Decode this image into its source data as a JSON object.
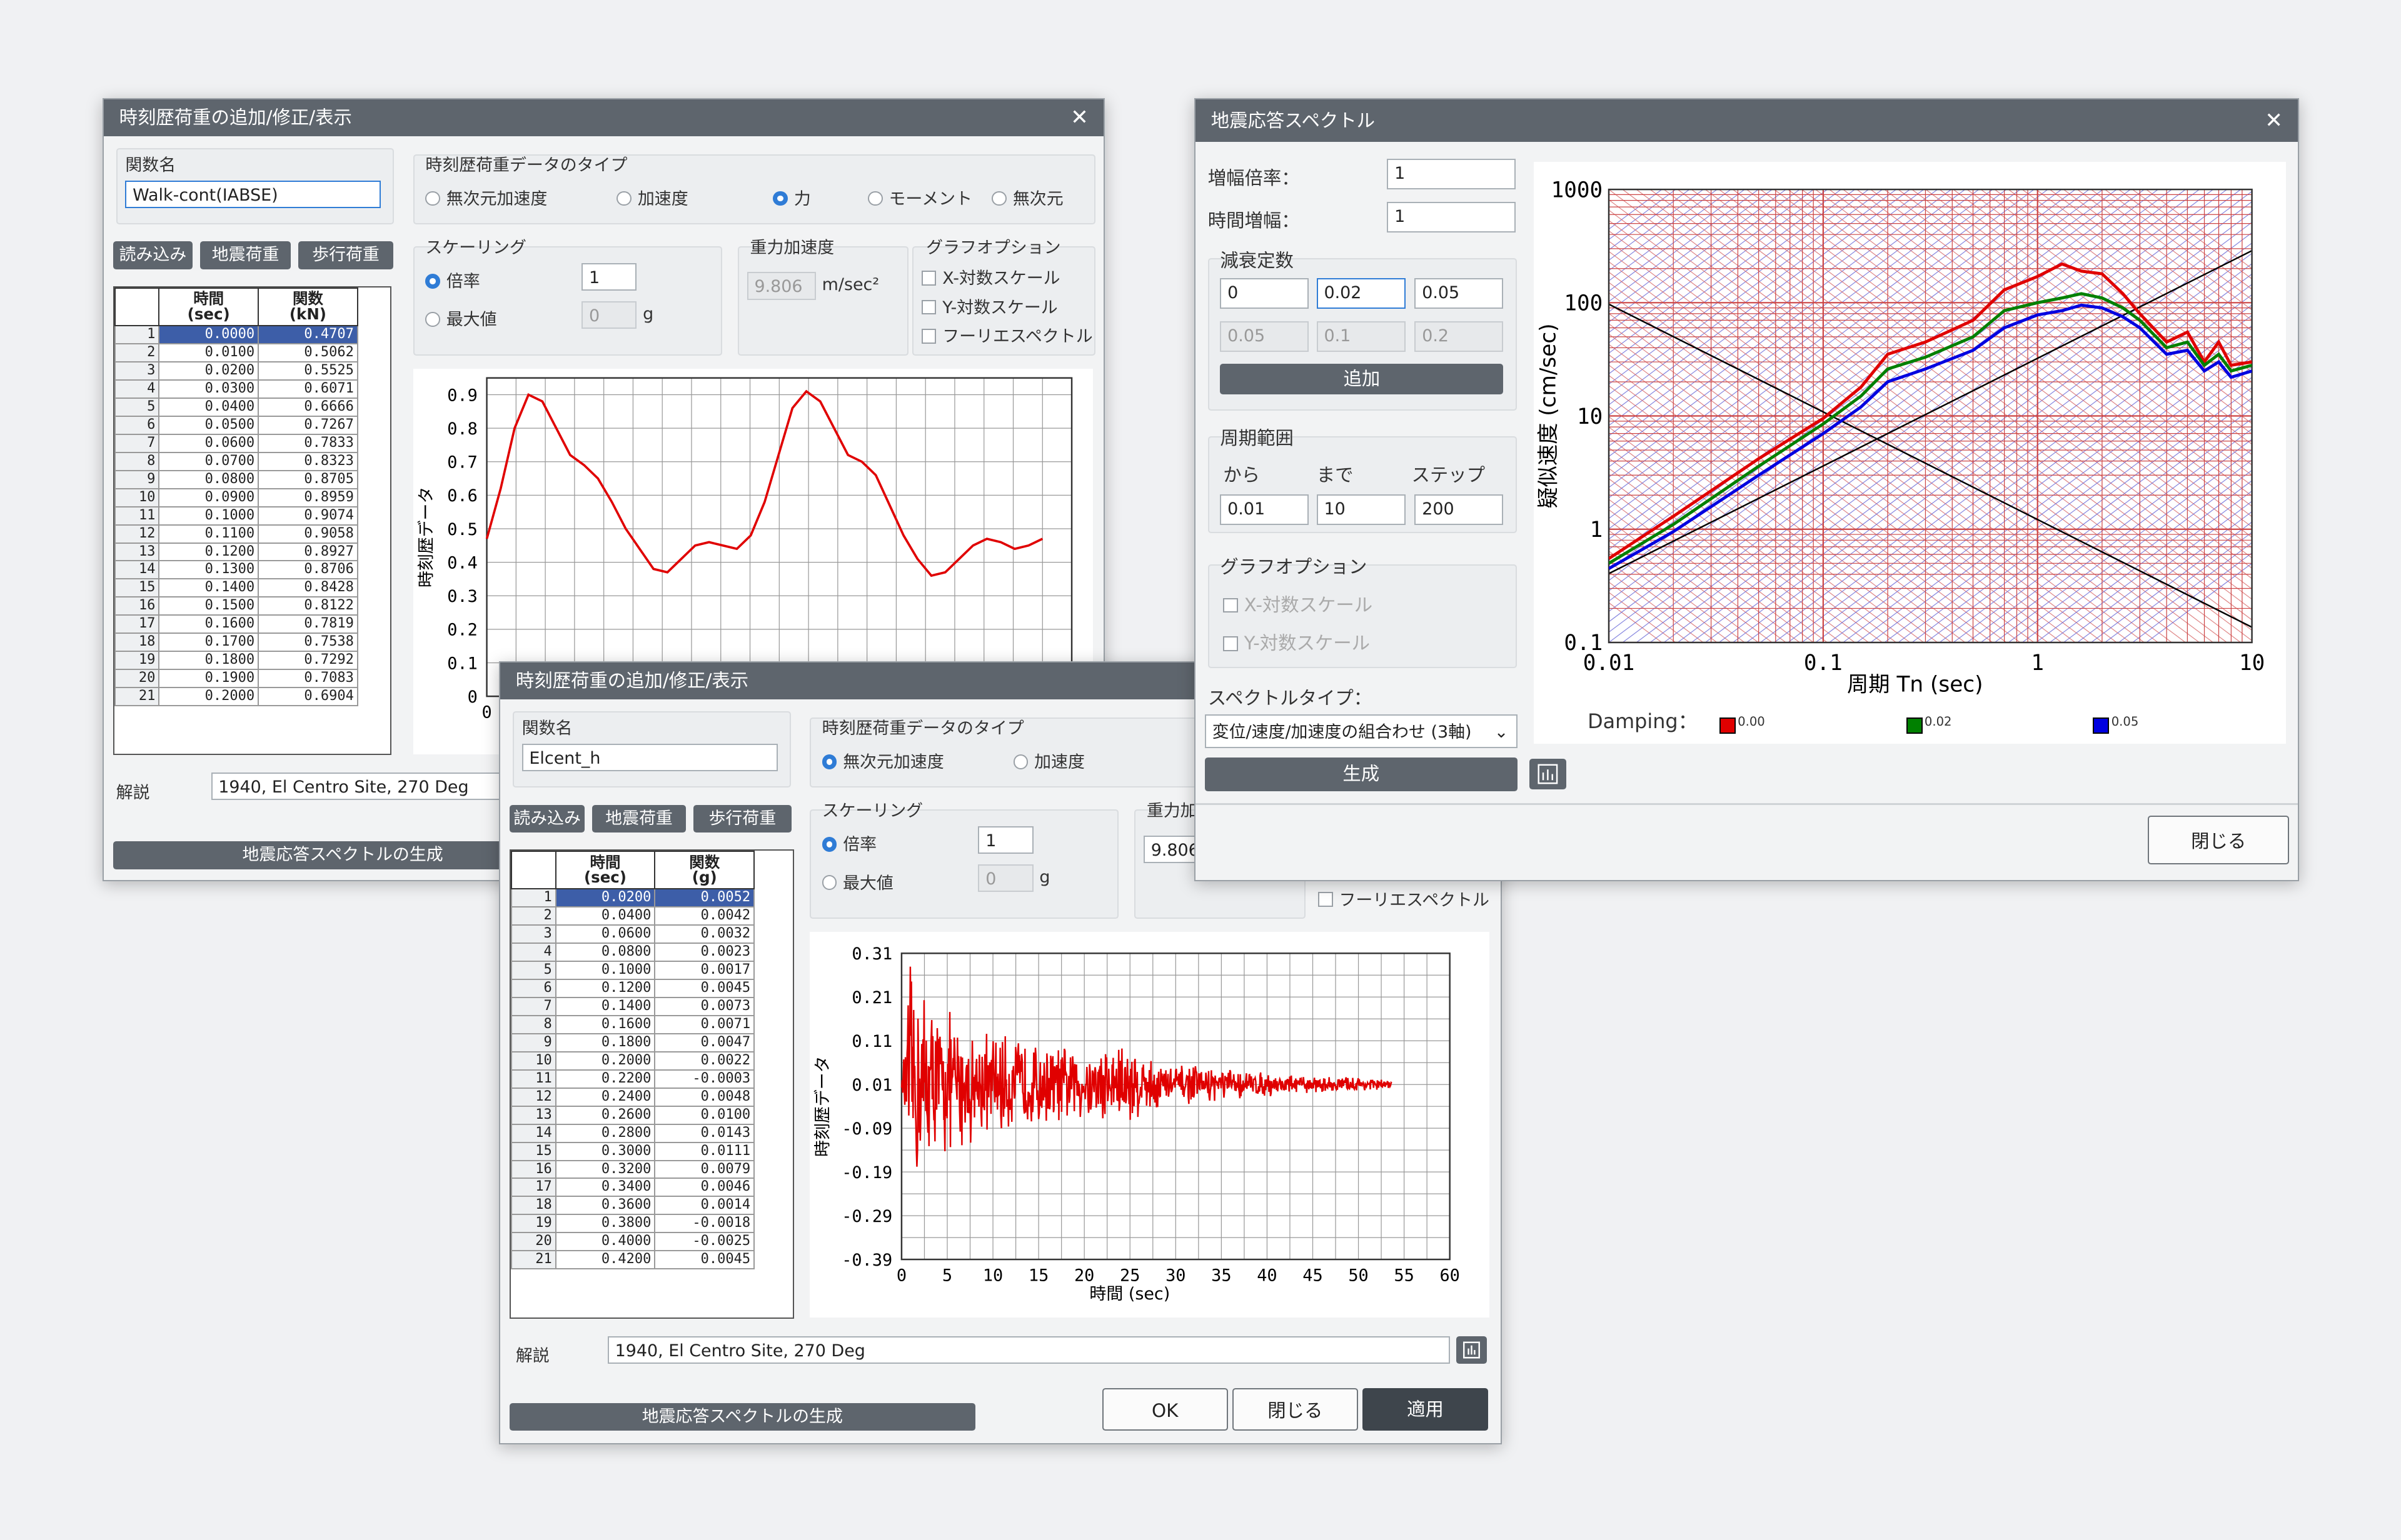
{
  "win1": {
    "title": "時刻歴荷重の追加/修正/表示",
    "close": "✕",
    "func_name_label": "関数名",
    "func_name_value": "Walk-cont(IABSE)",
    "buttons": [
      "読み込み",
      "地震荷重",
      "歩行荷重"
    ],
    "type_label": "時刻歴荷重データのタイプ",
    "types": [
      "無次元加速度",
      "加速度",
      "力",
      "モーメント",
      "無次元"
    ],
    "selected_type": "力",
    "scaling_label": "スケーリング",
    "scale_factor_label": "倍率",
    "scale_factor_value": "1",
    "max_label": "最大値",
    "max_value": "0",
    "max_unit": "g",
    "gravity_label": "重力加速度",
    "gravity_value": "9.806",
    "gravity_unit": "m/sec²",
    "graph_opt_label": "グラフオプション",
    "graph_opts": [
      "X-対数スケール",
      "Y-対数スケール",
      "フーリエスペクトル"
    ],
    "table_headers": [
      "時間\n(sec)",
      "関数\n(kN)"
    ],
    "table_rows": [
      [
        "1",
        "0.0000",
        "0.4707"
      ],
      [
        "2",
        "0.0100",
        "0.5062"
      ],
      [
        "3",
        "0.0200",
        "0.5525"
      ],
      [
        "4",
        "0.0300",
        "0.6071"
      ],
      [
        "5",
        "0.0400",
        "0.6666"
      ],
      [
        "6",
        "0.0500",
        "0.7267"
      ],
      [
        "7",
        "0.0600",
        "0.7833"
      ],
      [
        "8",
        "0.0700",
        "0.8323"
      ],
      [
        "9",
        "0.0800",
        "0.8705"
      ],
      [
        "10",
        "0.0900",
        "0.8959"
      ],
      [
        "11",
        "0.1000",
        "0.9074"
      ],
      [
        "12",
        "0.1100",
        "0.9058"
      ],
      [
        "13",
        "0.1200",
        "0.8927"
      ],
      [
        "14",
        "0.1300",
        "0.8706"
      ],
      [
        "15",
        "0.1400",
        "0.8428"
      ],
      [
        "16",
        "0.1500",
        "0.8122"
      ],
      [
        "17",
        "0.1600",
        "0.7819"
      ],
      [
        "18",
        "0.1700",
        "0.7538"
      ],
      [
        "19",
        "0.1800",
        "0.7292"
      ],
      [
        "20",
        "0.1900",
        "0.7083"
      ],
      [
        "21",
        "0.2000",
        "0.6904"
      ]
    ],
    "desc_label": "解説",
    "desc_value": "1940, El Centro Site, 270 Deg",
    "gen_button": "地震応答スペクトルの生成",
    "ylabel": "時刻歴データ",
    "yticks": [
      "0.9",
      "0.8",
      "0.7",
      "0.6",
      "0.5",
      "0.4",
      "0.3",
      "0.2",
      "0.1",
      "0"
    ],
    "xticks_visible": [
      "0"
    ]
  },
  "win2": {
    "title": "時刻歴荷重の追加/修正/表示",
    "func_name_label": "関数名",
    "func_name_value": "Elcent_h",
    "buttons": [
      "読み込み",
      "地震荷重",
      "歩行荷重"
    ],
    "type_label": "時刻歴荷重データのタイプ",
    "types": [
      "無次元加速度",
      "加速度"
    ],
    "selected_type": "無次元加速度",
    "scaling_label": "スケーリング",
    "scale_factor_label": "倍率",
    "scale_factor_value": "1",
    "max_label": "最大値",
    "max_value": "0",
    "max_unit": "g",
    "gravity_label": "重力加",
    "gravity_value": "9.806",
    "fourier_label": "フーリエスペクトル",
    "table_headers": [
      "時間\n(sec)",
      "関数\n(g)"
    ],
    "table_rows": [
      [
        "1",
        "0.0200",
        "0.0052"
      ],
      [
        "2",
        "0.0400",
        "0.0042"
      ],
      [
        "3",
        "0.0600",
        "0.0032"
      ],
      [
        "4",
        "0.0800",
        "0.0023"
      ],
      [
        "5",
        "0.1000",
        "0.0017"
      ],
      [
        "6",
        "0.1200",
        "0.0045"
      ],
      [
        "7",
        "0.1400",
        "0.0073"
      ],
      [
        "8",
        "0.1600",
        "0.0071"
      ],
      [
        "9",
        "0.1800",
        "0.0047"
      ],
      [
        "10",
        "0.2000",
        "0.0022"
      ],
      [
        "11",
        "0.2200",
        "-0.0003"
      ],
      [
        "12",
        "0.2400",
        "0.0048"
      ],
      [
        "13",
        "0.2600",
        "0.0100"
      ],
      [
        "14",
        "0.2800",
        "0.0143"
      ],
      [
        "15",
        "0.3000",
        "0.0111"
      ],
      [
        "16",
        "0.3200",
        "0.0079"
      ],
      [
        "17",
        "0.3400",
        "0.0046"
      ],
      [
        "18",
        "0.3600",
        "0.0014"
      ],
      [
        "19",
        "0.3800",
        "-0.0018"
      ],
      [
        "20",
        "0.4000",
        "-0.0025"
      ],
      [
        "21",
        "0.4200",
        "0.0045"
      ]
    ],
    "desc_label": "解説",
    "desc_value": "1940, El Centro Site, 270 Deg",
    "gen_button": "地震応答スペクトルの生成",
    "ok": "OK",
    "close_btn": "閉じる",
    "apply": "適用",
    "ylabel": "時刻歴データ",
    "xlabel": "時間 (sec)",
    "yticks": [
      "0.31",
      "0.21",
      "0.11",
      "0.01",
      "-0.09",
      "-0.19",
      "-0.29",
      "-0.39"
    ],
    "xticks": [
      "0",
      "5",
      "10",
      "15",
      "20",
      "25",
      "30",
      "35",
      "40",
      "45",
      "50",
      "55",
      "60"
    ]
  },
  "win3": {
    "title": "地震応答スペクトル",
    "close": "✕",
    "amp_label": "増幅倍率：",
    "amp_value": "1",
    "time_label": "時間増幅：",
    "time_value": "1",
    "damping_group": "減衰定数",
    "damping_values": [
      "0",
      "0.02",
      "0.05"
    ],
    "damping_disabled": [
      "0.05",
      "0.1",
      "0.2"
    ],
    "add_button": "追加",
    "period_group": "周期範囲",
    "from_label": "から",
    "to_label": "まで",
    "step_label": "ステップ",
    "from_value": "0.01",
    "to_value": "10",
    "step_value": "200",
    "graph_opt_label": "グラフオプション",
    "graph_opts": [
      "X-対数スケール",
      "Y-対数スケール"
    ],
    "spectrum_type_label": "スペクトルタイプ：",
    "spectrum_type_value": "変位/速度/加速度の組合わせ (3軸)",
    "generate_button": "生成",
    "close_button": "閉じる",
    "ylabel": "疑似速度 (cm/sec)",
    "xlabel": "周期 Tn (sec)",
    "yticks": [
      "1000",
      "100",
      "10",
      "1",
      "0.1"
    ],
    "xticks": [
      "0.01",
      "0.1",
      "1",
      "10"
    ],
    "damping_label": "Damping：",
    "legend": [
      {
        "name": "0.00",
        "color": "#e00000"
      },
      {
        "name": "0.02",
        "color": "#008000"
      },
      {
        "name": "0.05",
        "color": "#0000e0"
      }
    ]
  },
  "chart_data": [
    {
      "type": "line",
      "ylabel": "時刻歴データ",
      "ylim": [
        0,
        0.95
      ],
      "series": [
        {
          "color": "#e00000",
          "x": [
            0,
            0.0125,
            0.025,
            0.0375,
            0.05,
            0.0625,
            0.075,
            0.0875,
            0.1,
            0.1125,
            0.125,
            0.1375,
            0.15,
            0.1625,
            0.175,
            0.1875,
            0.2,
            0.2125,
            0.225,
            0.2375,
            0.25,
            0.2625,
            0.275,
            0.2875,
            0.3,
            0.3125,
            0.325,
            0.3375,
            0.35,
            0.3625,
            0.375,
            0.3875,
            0.4,
            0.4125,
            0.425,
            0.4375,
            0.45,
            0.4625,
            0.475,
            0.4875,
            0.5
          ],
          "values": [
            0.47,
            0.62,
            0.8,
            0.9,
            0.88,
            0.8,
            0.72,
            0.69,
            0.65,
            0.58,
            0.5,
            0.44,
            0.38,
            0.37,
            0.41,
            0.45,
            0.46,
            0.45,
            0.44,
            0.48,
            0.58,
            0.72,
            0.86,
            0.91,
            0.88,
            0.8,
            0.72,
            0.7,
            0.66,
            0.57,
            0.48,
            0.41,
            0.36,
            0.37,
            0.41,
            0.45,
            0.47,
            0.46,
            0.44,
            0.45,
            0.47
          ]
        }
      ]
    },
    {
      "type": "line",
      "xlabel": "時間 (sec)",
      "ylabel": "時刻歴データ",
      "xlim": [
        0,
        60
      ],
      "ylim": [
        -0.39,
        0.31
      ],
      "series": [
        {
          "color": "#e00000",
          "note_envelope": [
            [
              0,
              0.01
            ],
            [
              1,
              0.3
            ],
            [
              2,
              0.28
            ],
            [
              3,
              0.22
            ],
            [
              5,
              0.18
            ],
            [
              8,
              0.14
            ],
            [
              12,
              0.12
            ],
            [
              16,
              0.1
            ],
            [
              20,
              0.09
            ],
            [
              25,
              0.12
            ],
            [
              26,
              0.08
            ],
            [
              30,
              0.05
            ],
            [
              35,
              0.04
            ],
            [
              40,
              0.03
            ],
            [
              45,
              0.02
            ],
            [
              50,
              0.02
            ],
            [
              53.7,
              0.01
            ]
          ]
        }
      ]
    },
    {
      "type": "line",
      "xlabel": "周期 Tn (sec)",
      "ylabel": "疑似速度 (cm/sec)",
      "xscale": "log",
      "yscale": "log",
      "xlim": [
        0.01,
        10
      ],
      "ylim": [
        0.1,
        1000
      ],
      "series": [
        {
          "name": "0.00",
          "color": "#e00000",
          "x": [
            0.01,
            0.02,
            0.05,
            0.1,
            0.15,
            0.2,
            0.3,
            0.5,
            0.7,
            1,
            1.3,
            1.6,
            2,
            2.5,
            3,
            4,
            5,
            6,
            7,
            8,
            10
          ],
          "values": [
            0.55,
            1.3,
            4.2,
            9.5,
            18,
            35,
            45,
            70,
            130,
            170,
            220,
            190,
            180,
            120,
            80,
            45,
            55,
            30,
            45,
            28,
            30
          ]
        },
        {
          "name": "0.02",
          "color": "#008000",
          "x": [
            0.01,
            0.02,
            0.05,
            0.1,
            0.15,
            0.2,
            0.3,
            0.5,
            0.7,
            1,
            1.3,
            1.6,
            2,
            2.5,
            3,
            4,
            5,
            6,
            7,
            8,
            10
          ],
          "values": [
            0.5,
            1.1,
            3.6,
            8.5,
            15,
            26,
            33,
            50,
            85,
            100,
            110,
            120,
            110,
            90,
            70,
            40,
            45,
            28,
            35,
            25,
            28
          ]
        },
        {
          "name": "0.05",
          "color": "#0000e0",
          "x": [
            0.01,
            0.02,
            0.05,
            0.1,
            0.15,
            0.2,
            0.3,
            0.5,
            0.7,
            1,
            1.3,
            1.6,
            2,
            2.5,
            3,
            4,
            5,
            6,
            7,
            8,
            10
          ],
          "values": [
            0.45,
            0.95,
            3.0,
            7.0,
            12,
            20,
            26,
            38,
            60,
            78,
            85,
            95,
            90,
            75,
            60,
            35,
            38,
            25,
            30,
            22,
            25
          ]
        }
      ]
    }
  ]
}
